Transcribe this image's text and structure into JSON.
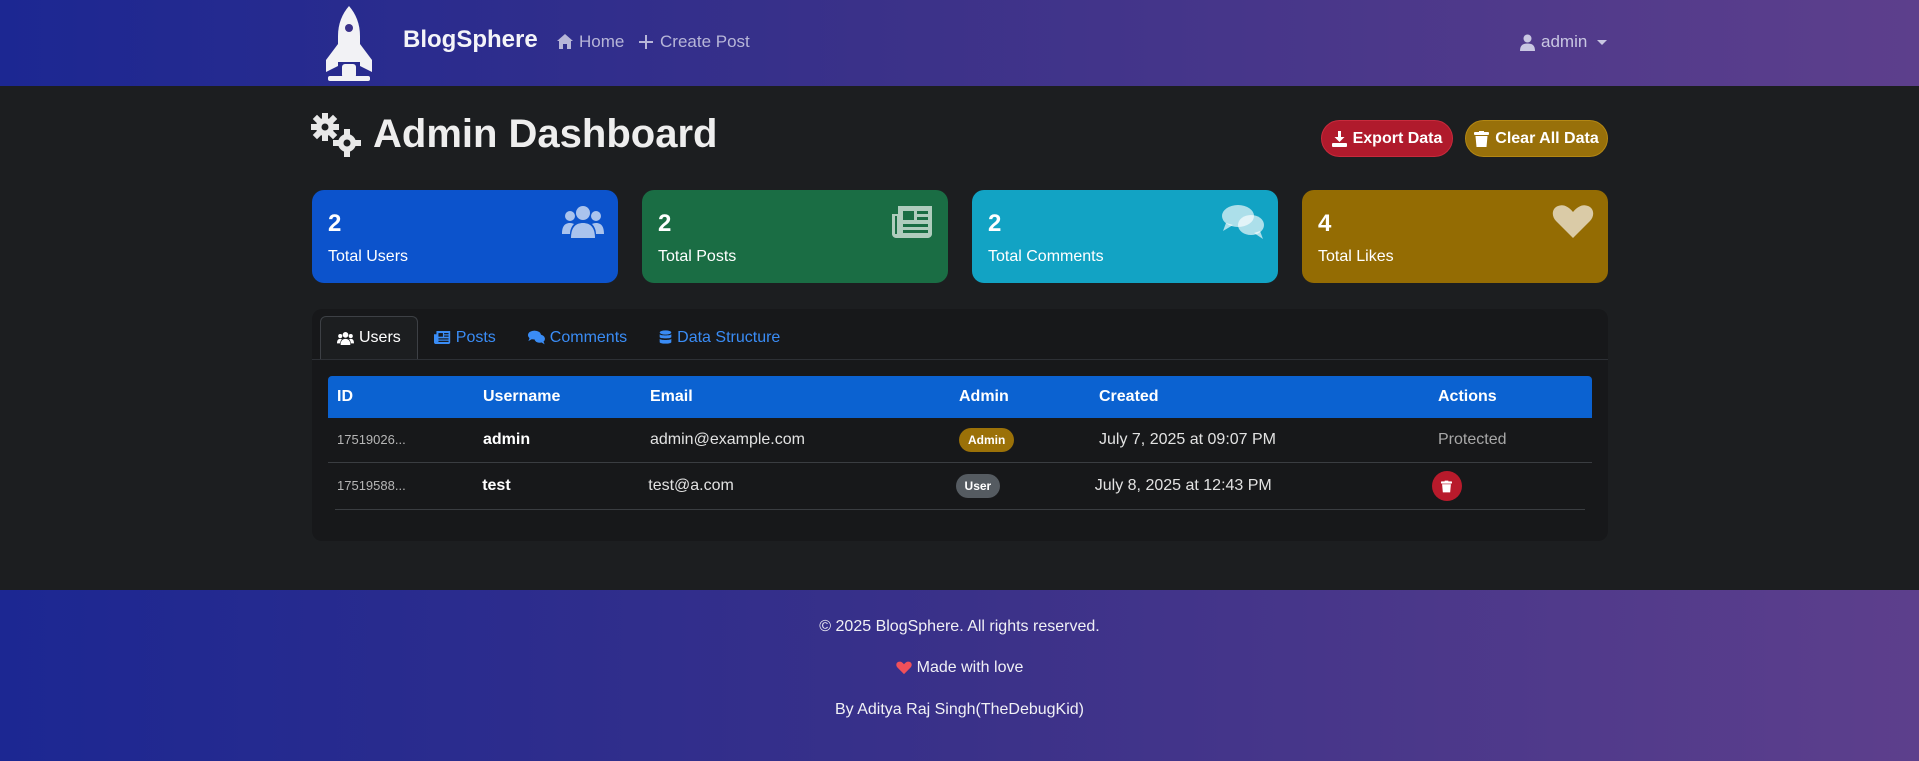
{
  "nav": {
    "brand": "BlogSphere",
    "home_label": "Home",
    "create_label": "Create Post",
    "user_label": "admin"
  },
  "header": {
    "title": "Admin Dashboard",
    "export_label": "Export Data",
    "clear_label": "Clear All Data"
  },
  "stats": [
    {
      "value": "2",
      "label": "Total Users",
      "icon": "users-icon",
      "color": "#0c53cc"
    },
    {
      "value": "2",
      "label": "Total Posts",
      "icon": "newspaper-icon",
      "color": "#1a6d44"
    },
    {
      "value": "2",
      "label": "Total Comments",
      "icon": "comments-icon",
      "color": "#12a3c4"
    },
    {
      "value": "4",
      "label": "Total Likes",
      "icon": "heart-icon",
      "color": "#946c03"
    }
  ],
  "tabs": [
    {
      "label": "Users",
      "icon": "users-icon",
      "active": true
    },
    {
      "label": "Posts",
      "icon": "newspaper-icon"
    },
    {
      "label": "Comments",
      "icon": "comments-icon"
    },
    {
      "label": "Data Structure",
      "icon": "database-icon"
    }
  ],
  "table": {
    "columns": [
      "ID",
      "Username",
      "Email",
      "Admin",
      "Created",
      "Actions"
    ],
    "rows": [
      {
        "id": "17519026...",
        "username": "admin",
        "email": "admin@example.com",
        "role": "Admin",
        "created": "July 7, 2025 at 09:07 PM",
        "action": "Protected"
      },
      {
        "id": "17519588...",
        "username": "test",
        "email": "test@a.com",
        "role": "User",
        "created": "July 8, 2025 at 12:43 PM",
        "action": "delete"
      }
    ]
  },
  "footer": {
    "copyright": "© 2025 BlogSphere. All rights reserved.",
    "love": "Made with love",
    "author": "By Aditya Raj Singh(TheDebugKid)"
  }
}
